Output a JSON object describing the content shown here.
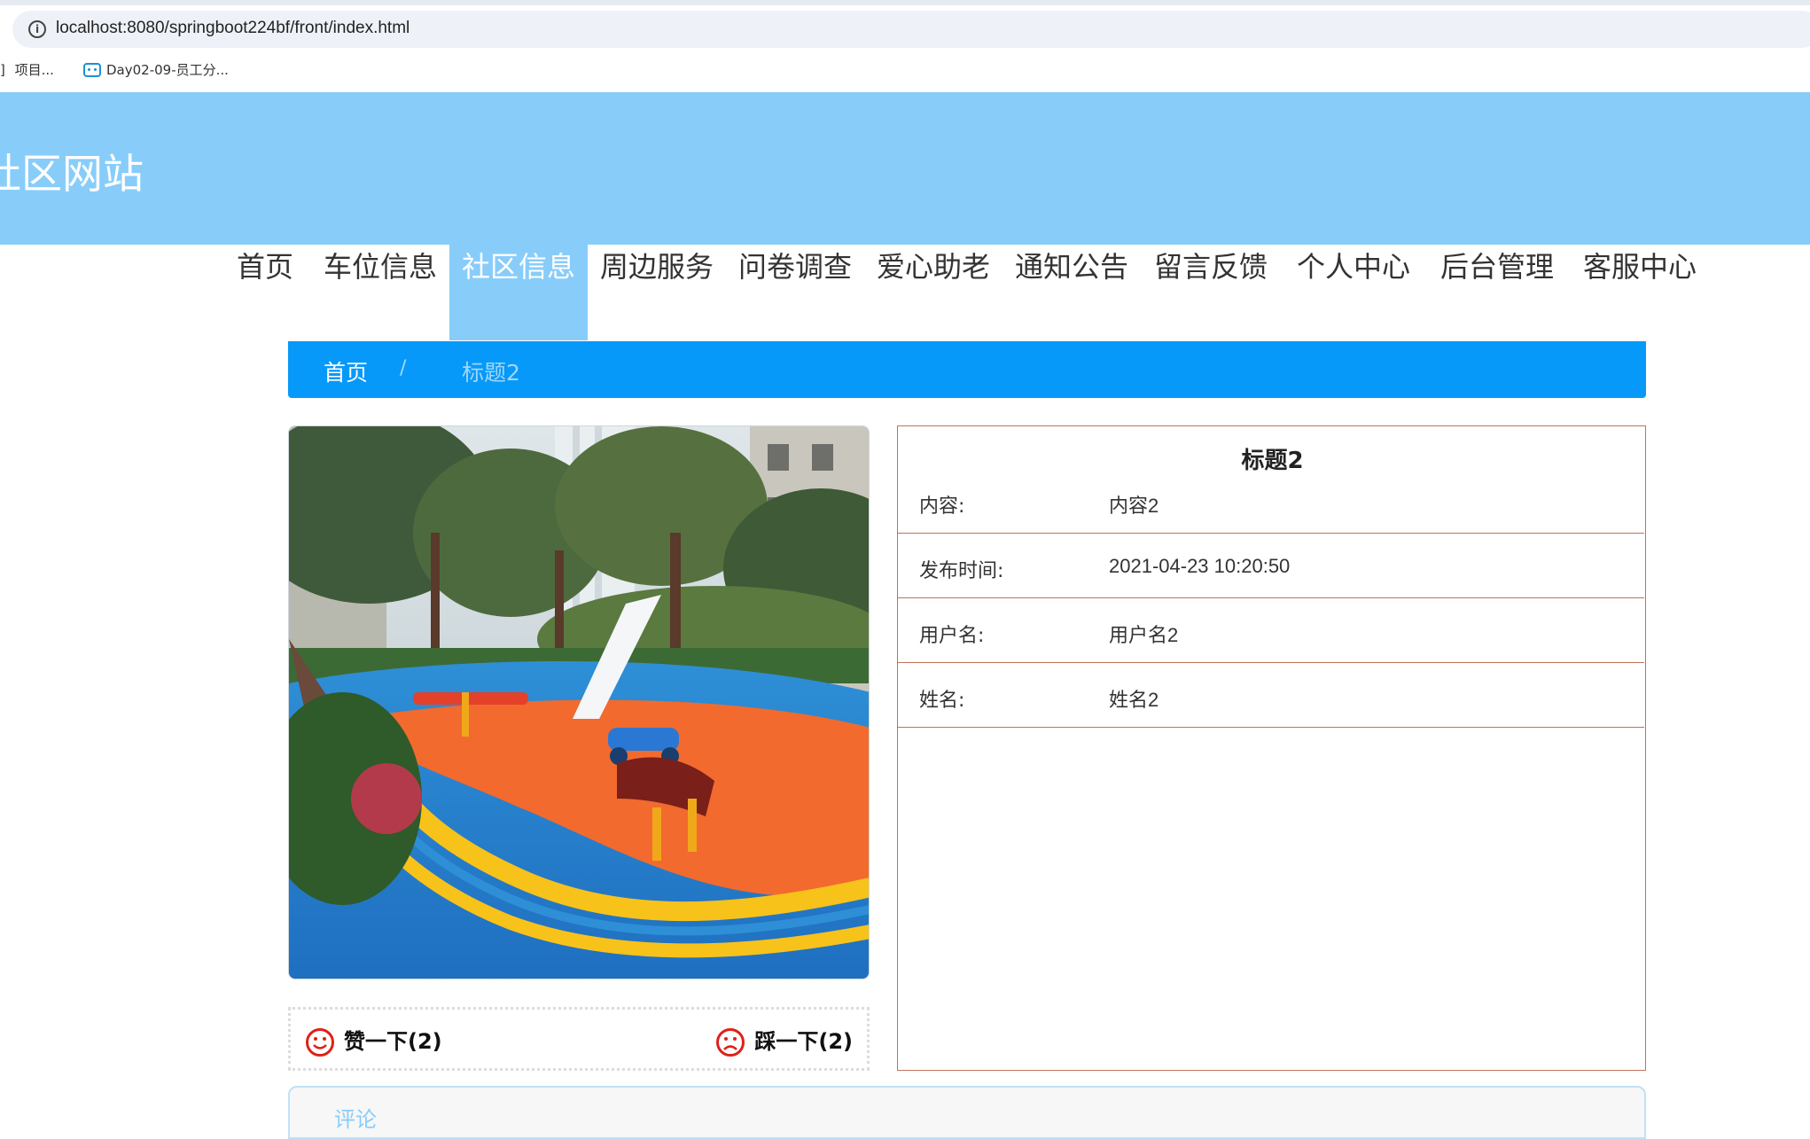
{
  "browser": {
    "url": "localhost:8080/springboot224bf/front/index.html",
    "info_icon": "i",
    "bookmarks": [
      {
        "label": "项目...",
        "prefix": "]"
      },
      {
        "label": "Day02-09-员工分..."
      }
    ]
  },
  "site": {
    "title": "社区网站",
    "header_color": "#88cdfa"
  },
  "nav": {
    "items": [
      {
        "label": "首页"
      },
      {
        "label": "车位信息"
      },
      {
        "label": "社区信息",
        "active": true
      },
      {
        "label": "周边服务"
      },
      {
        "label": "问卷调查"
      },
      {
        "label": "爱心助老"
      },
      {
        "label": "通知公告"
      },
      {
        "label": "留言反馈"
      },
      {
        "label": "个人中心"
      },
      {
        "label": "后台管理"
      },
      {
        "label": "客服中心"
      }
    ]
  },
  "breadcrumb": {
    "home": "首页",
    "separator": "/",
    "current": "标题2",
    "color": "#0699f9"
  },
  "votes": {
    "like_label": "赞一下(2)",
    "dislike_label": "踩一下(2)",
    "icon_color": "#e0201a"
  },
  "detail": {
    "title": "标题2",
    "rows": [
      {
        "label": "内容:",
        "value": "内容2"
      },
      {
        "label": "发布时间:",
        "value": "2021-04-23 10:20:50"
      },
      {
        "label": "用户名:",
        "value": "用户名2"
      },
      {
        "label": "姓名:",
        "value": "姓名2"
      }
    ],
    "border_color": "#c0735a"
  },
  "comments": {
    "label": "评论"
  }
}
